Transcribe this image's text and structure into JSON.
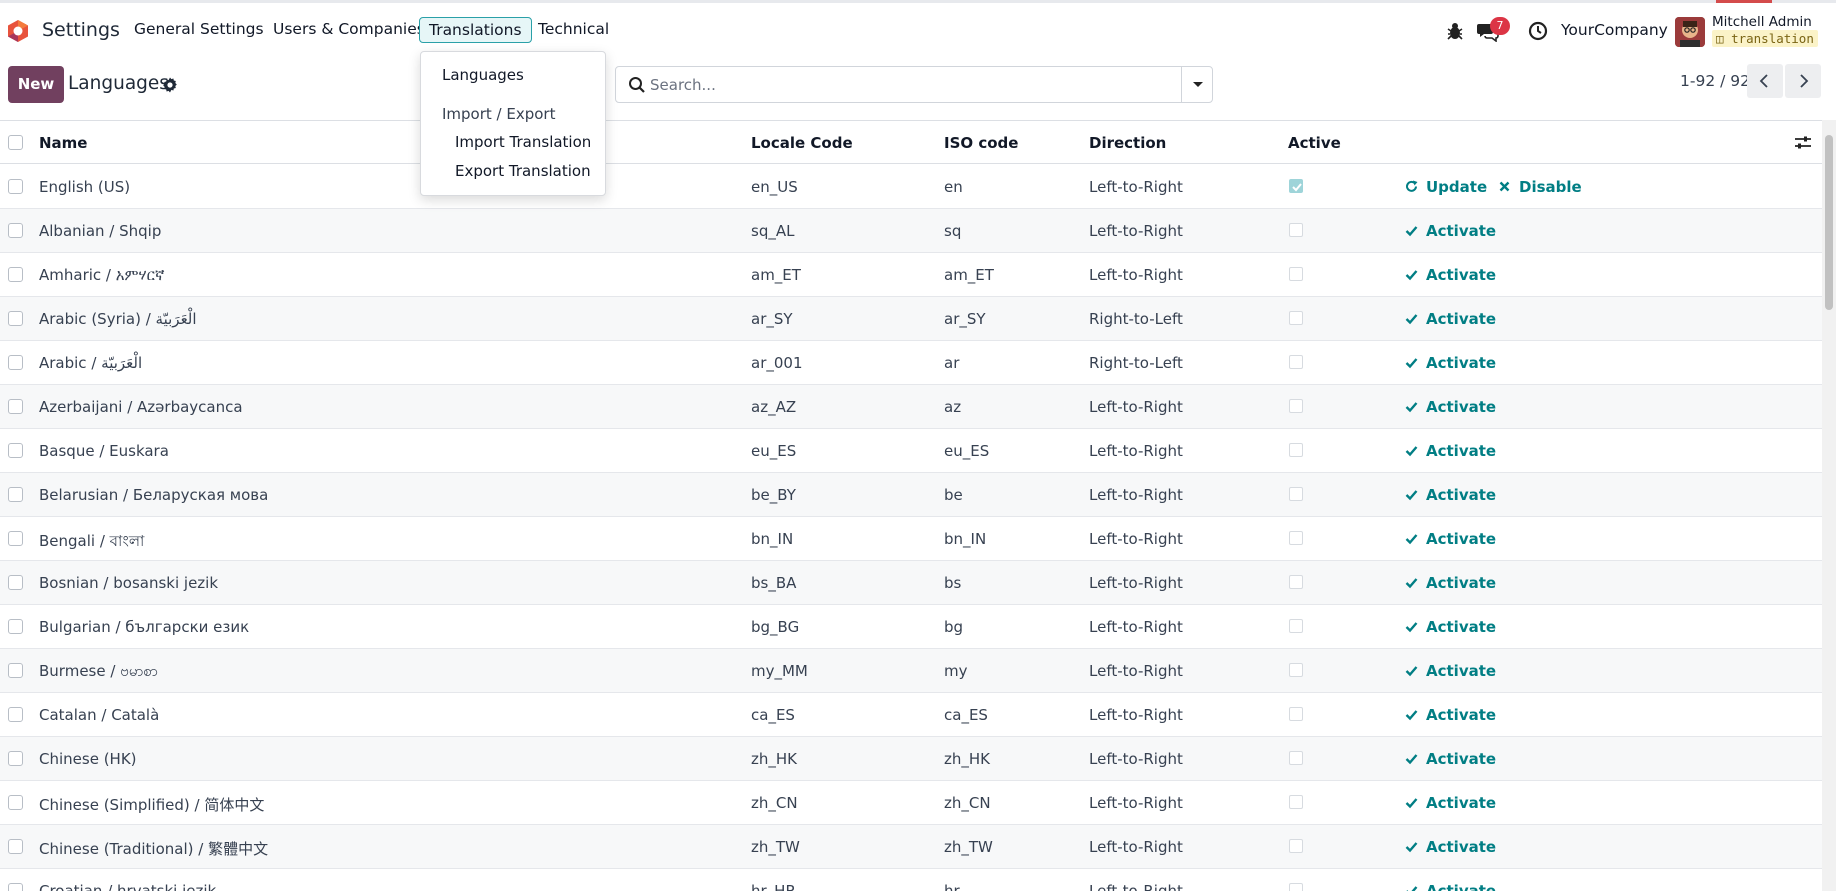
{
  "app": {
    "title": "Settings"
  },
  "nav": {
    "menus": [
      "General Settings",
      "Users & Companies",
      "Translations",
      "Technical"
    ],
    "active_menu": "Translations"
  },
  "systray": {
    "message_count": "7",
    "company": "YourCompany",
    "user_name": "Mitchell Admin",
    "database": "translation"
  },
  "control_panel": {
    "new_label": "New",
    "title": "Languages"
  },
  "search": {
    "placeholder": "Search..."
  },
  "pager": {
    "value": "1-92 / 92"
  },
  "table": {
    "headers": {
      "name": "Name",
      "locale": "Locale Code",
      "iso": "ISO code",
      "direction": "Direction",
      "active": "Active"
    },
    "rows": [
      {
        "name": "English (US)",
        "locale": "en_US",
        "iso": "en",
        "direction": "Left-to-Right",
        "active": true
      },
      {
        "name": "Albanian / Shqip",
        "locale": "sq_AL",
        "iso": "sq",
        "direction": "Left-to-Right",
        "active": false
      },
      {
        "name": "Amharic / አምሃርኛ",
        "locale": "am_ET",
        "iso": "am_ET",
        "direction": "Left-to-Right",
        "active": false
      },
      {
        "name": "Arabic (Syria) / الْعَرَبيّة",
        "locale": "ar_SY",
        "iso": "ar_SY",
        "direction": "Right-to-Left",
        "active": false
      },
      {
        "name": "Arabic / الْعَرَبيّة",
        "locale": "ar_001",
        "iso": "ar",
        "direction": "Right-to-Left",
        "active": false
      },
      {
        "name": "Azerbaijani / Azərbaycanca",
        "locale": "az_AZ",
        "iso": "az",
        "direction": "Left-to-Right",
        "active": false
      },
      {
        "name": "Basque / Euskara",
        "locale": "eu_ES",
        "iso": "eu_ES",
        "direction": "Left-to-Right",
        "active": false
      },
      {
        "name": "Belarusian / Беларуская мова",
        "locale": "be_BY",
        "iso": "be",
        "direction": "Left-to-Right",
        "active": false
      },
      {
        "name": "Bengali / বাংলা",
        "locale": "bn_IN",
        "iso": "bn_IN",
        "direction": "Left-to-Right",
        "active": false
      },
      {
        "name": "Bosnian / bosanski jezik",
        "locale": "bs_BA",
        "iso": "bs",
        "direction": "Left-to-Right",
        "active": false
      },
      {
        "name": "Bulgarian / български език",
        "locale": "bg_BG",
        "iso": "bg",
        "direction": "Left-to-Right",
        "active": false
      },
      {
        "name": "Burmese / ဗမာစာ",
        "locale": "my_MM",
        "iso": "my",
        "direction": "Left-to-Right",
        "active": false
      },
      {
        "name": "Catalan / Català",
        "locale": "ca_ES",
        "iso": "ca_ES",
        "direction": "Left-to-Right",
        "active": false
      },
      {
        "name": "Chinese (HK)",
        "locale": "zh_HK",
        "iso": "zh_HK",
        "direction": "Left-to-Right",
        "active": false
      },
      {
        "name": "Chinese (Simplified) / 简体中文",
        "locale": "zh_CN",
        "iso": "zh_CN",
        "direction": "Left-to-Right",
        "active": false
      },
      {
        "name": "Chinese (Traditional) / 繁體中文",
        "locale": "zh_TW",
        "iso": "zh_TW",
        "direction": "Left-to-Right",
        "active": false
      },
      {
        "name": "Croatian / hrvatski jezik",
        "locale": "hr_HR",
        "iso": "hr",
        "direction": "Left-to-Right",
        "active": false
      }
    ],
    "actions": {
      "update": "Update",
      "disable": "Disable",
      "activate": "Activate"
    }
  },
  "translations_menu": {
    "languages": "Languages",
    "section_header": "Import / Export",
    "import": "Import Translation",
    "export": "Export Translation"
  },
  "colors": {
    "brand": "#71405f",
    "accent": "#017e84",
    "badge": "#dc3545"
  }
}
